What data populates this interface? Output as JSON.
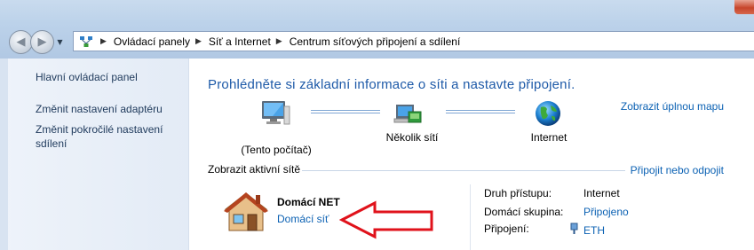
{
  "address_bar": {
    "crumbs": [
      "Ovládací panely",
      "Síť a Internet",
      "Centrum síťových připojení a sdílení"
    ]
  },
  "left_pane": {
    "links": [
      "Hlavní ovládací panel",
      "Změnit nastavení adaptéru",
      "Změnit pokročilé nastavení",
      "sdílení"
    ]
  },
  "main": {
    "heading": "Prohlédněte si základní informace o síti a nastavte připojení.",
    "full_map": "Zobrazit úplnou mapu",
    "nodes": [
      "(Tento počítač)",
      "Několik sítí",
      "Internet"
    ],
    "active_networks_label": "Zobrazit aktivní sítě",
    "connect_disconnect": "Připojit nebo odpojit",
    "network": {
      "name": "Domácí NET",
      "type": "Domácí síť"
    },
    "properties": {
      "access_type_label": "Druh přístupu:",
      "access_type_value": "Internet",
      "homegroup_label": "Domácí skupina:",
      "homegroup_value": "Připojeno",
      "connections_label": "Připojení:",
      "connections_value": "ETH"
    }
  },
  "colors": {
    "link": "#0b61b3",
    "heading": "#1e5aa8",
    "annotation_arrow": "#e0121b"
  }
}
